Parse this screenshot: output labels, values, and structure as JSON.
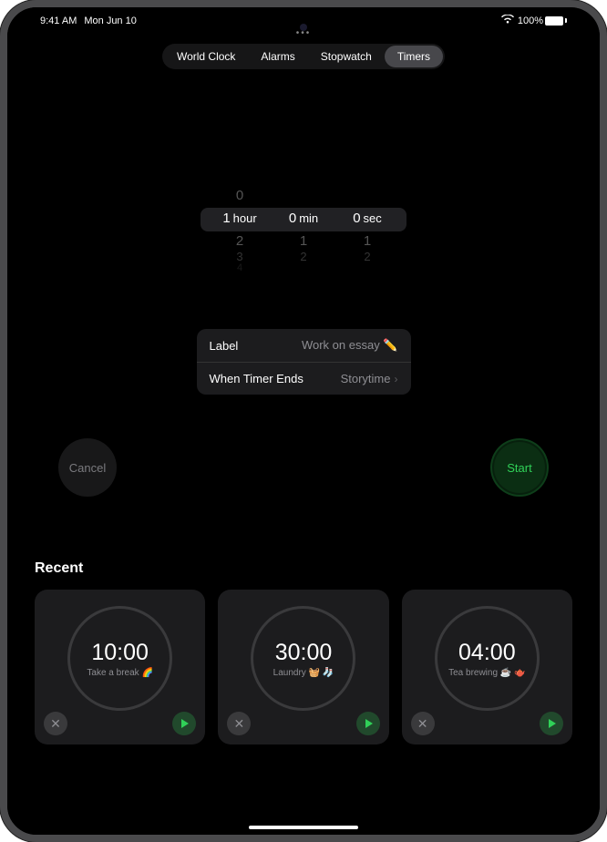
{
  "status": {
    "time": "9:41 AM",
    "date": "Mon Jun 10",
    "battery": "100%"
  },
  "tabs": {
    "world_clock": "World Clock",
    "alarms": "Alarms",
    "stopwatch": "Stopwatch",
    "timers": "Timers"
  },
  "picker": {
    "hours_above": "0",
    "hours_selected": "1",
    "hours_unit": "hour",
    "hours_below1": "2",
    "hours_below2": "3",
    "hours_below3": "4",
    "min_selected": "0",
    "min_unit": "min",
    "min_below1": "1",
    "min_below2": "2",
    "sec_selected": "0",
    "sec_unit": "sec",
    "sec_below1": "1",
    "sec_below2": "2"
  },
  "settings": {
    "label_key": "Label",
    "label_value": "Work on essay ✏️",
    "ends_key": "When Timer Ends",
    "ends_value": "Storytime"
  },
  "actions": {
    "cancel": "Cancel",
    "start": "Start"
  },
  "recent": {
    "title": "Recent",
    "cards": [
      {
        "time": "10:00",
        "label": "Take a break 🌈"
      },
      {
        "time": "30:00",
        "label": "Laundry 🧺 🧦"
      },
      {
        "time": "04:00",
        "label": "Tea brewing ☕️ 🫖"
      }
    ]
  }
}
